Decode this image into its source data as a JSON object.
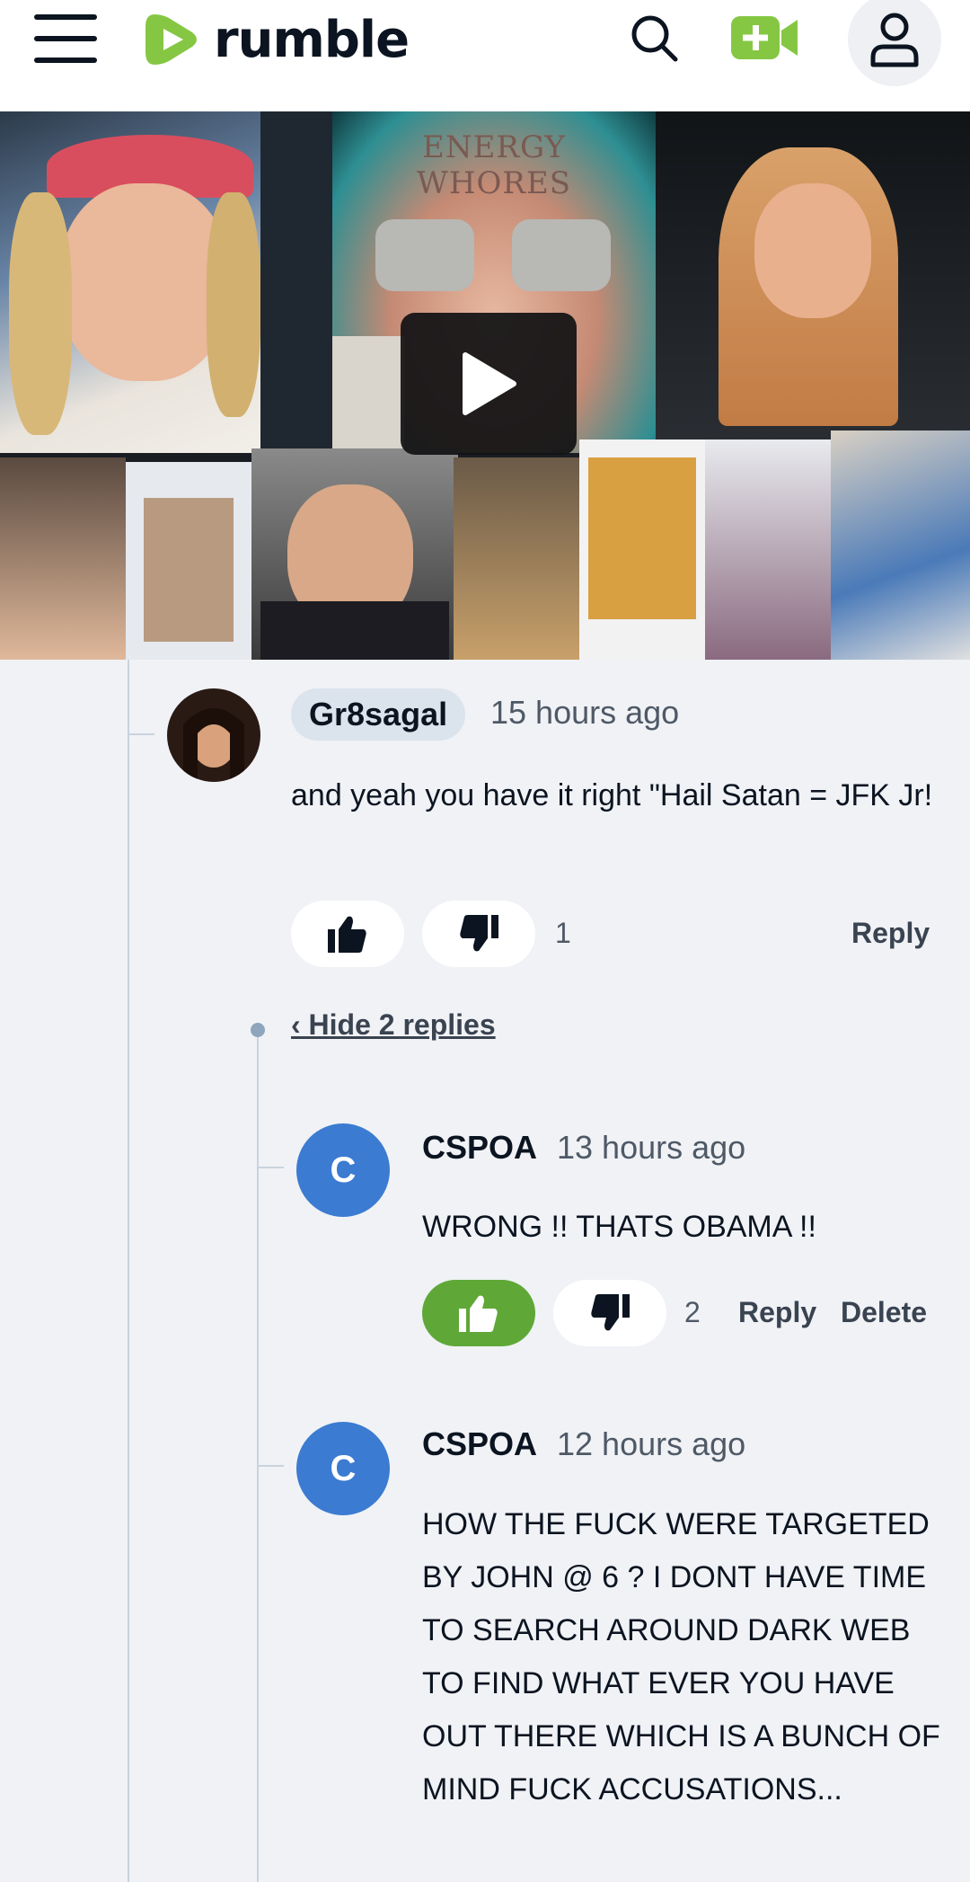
{
  "header": {
    "logo_text": "rumble",
    "brand_color": "#85c742",
    "icons": [
      "menu-icon",
      "search-icon",
      "upload-video-icon",
      "account-icon"
    ]
  },
  "video": {
    "thumbnail_caption": "ENERGY WHORES",
    "play_icon": "play-icon"
  },
  "comments": [
    {
      "username": "Gr8sagal",
      "time": "15 hours ago",
      "text": "and yeah you have it right \"Hail Satan = JFK Jr!",
      "vote_count": "1",
      "reply_label": "Reply",
      "hide_replies_label": "‹ Hide 2 replies",
      "replies": [
        {
          "avatar_letter": "C",
          "username": "CSPOA",
          "time": "13 hours ago",
          "text": "WRONG !! THATS OBAMA !!",
          "vote_count": "2",
          "upvoted": true,
          "reply_label": "Reply",
          "delete_label": "Delete"
        },
        {
          "avatar_letter": "C",
          "username": "CSPOA",
          "time": "12 hours ago",
          "text": "HOW THE FUCK WERE TARGETED BY JOHN @ 6 ? I DONT HAVE TIME TO SEARCH AROUND DARK WEB TO FIND WHAT EVER YOU HAVE OUT THERE WHICH IS A BUNCH OF MIND FUCK ACCUSATIONS..."
        }
      ]
    }
  ],
  "colors": {
    "upvote_active": "#5fa838",
    "avatar_blue": "#3b7bd1",
    "page_bg": "#f0f2f6"
  }
}
